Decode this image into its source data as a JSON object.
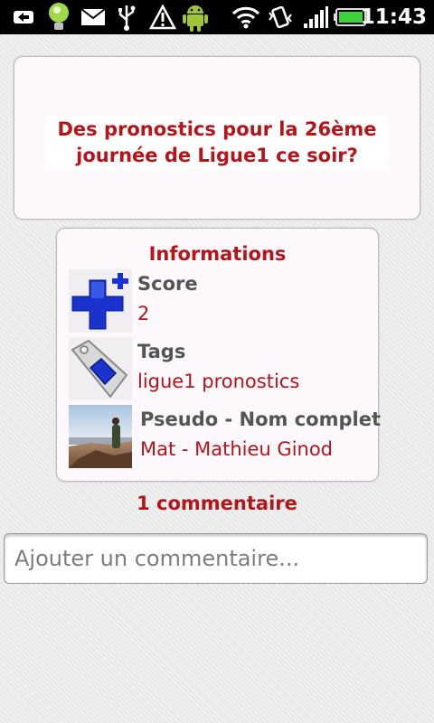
{
  "status_bar": {
    "time": "11:43",
    "icons": [
      "usb-connected-icon",
      "lightbulb-notification-icon",
      "mail-icon",
      "usb-icon",
      "warning-icon",
      "android-icon",
      "wifi-icon",
      "vibrate-icon",
      "signal-icon",
      "battery-icon"
    ]
  },
  "question": {
    "line1": "Des pronostics pour la 26ème",
    "line2": "journée de Ligue1 ce soir?"
  },
  "info": {
    "title": "Informations",
    "score_label": "Score",
    "score_value": "2",
    "tags_label": "Tags",
    "tags_value": "ligue1 pronostics",
    "author_label": "Pseudo - Nom complet",
    "author_value": "Mat - Mathieu Ginod"
  },
  "comments": {
    "count_label": "1 commentaire",
    "input_placeholder": "Ajouter un commentaire..."
  },
  "colors": {
    "accent": "#b3151b",
    "label": "#555555",
    "score_icon_blue": "#1a33cc"
  }
}
